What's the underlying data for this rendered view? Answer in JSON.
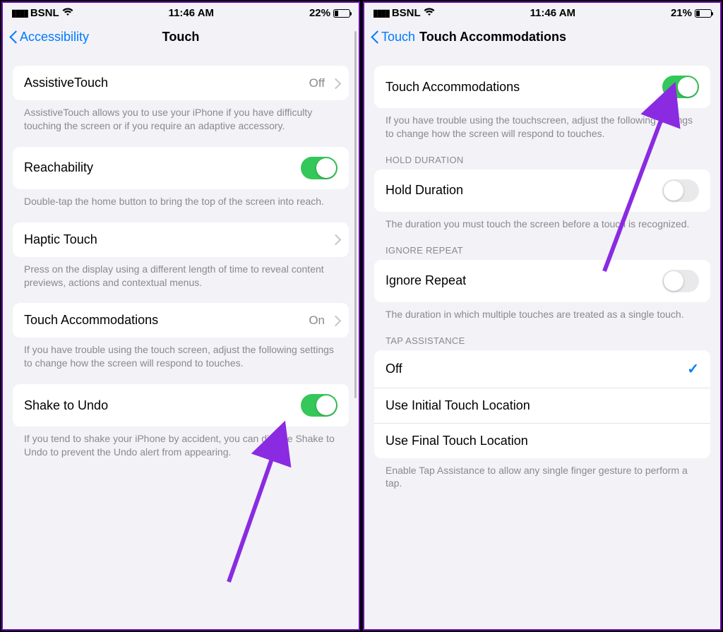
{
  "left": {
    "status": {
      "carrier": "BSNL",
      "time": "11:46 AM",
      "battery_pct": "22%",
      "battery_fill": 22
    },
    "nav": {
      "back": "Accessibility",
      "title": "Touch"
    },
    "rows": {
      "assistive": {
        "label": "AssistiveTouch",
        "value": "Off",
        "footer": "AssistiveTouch allows you to use your iPhone if you have difficulty touching the screen or if you require an adaptive accessory."
      },
      "reach": {
        "label": "Reachability",
        "on": true,
        "footer": "Double-tap the home button to bring the top of the screen into reach."
      },
      "haptic": {
        "label": "Haptic Touch",
        "footer": "Press on the display using a different length of time to reveal content previews, actions and contextual menus."
      },
      "accom": {
        "label": "Touch Accommodations",
        "value": "On",
        "footer": "If you have trouble using the touch screen, adjust the following settings to change how the screen will respond to touches."
      },
      "shake": {
        "label": "Shake to Undo",
        "on": true,
        "footer": "If you tend to shake your iPhone by accident, you can disable Shake to Undo to prevent the Undo alert from appearing."
      }
    }
  },
  "right": {
    "status": {
      "carrier": "BSNL",
      "time": "11:46 AM",
      "battery_pct": "21%",
      "battery_fill": 21
    },
    "nav": {
      "back": "Touch",
      "title": "Touch Accommodations"
    },
    "main": {
      "label": "Touch Accommodations",
      "on": true,
      "footer": "If you have trouble using the touchscreen, adjust the following settings to change how the screen will respond to touches."
    },
    "hold": {
      "header": "HOLD DURATION",
      "label": "Hold Duration",
      "on": false,
      "footer": "The duration you must touch the screen before a touch is recognized."
    },
    "ignore": {
      "header": "IGNORE REPEAT",
      "label": "Ignore Repeat",
      "on": false,
      "footer": "The duration in which multiple touches are treated as a single touch."
    },
    "tap": {
      "header": "TAP ASSISTANCE",
      "options": [
        "Off",
        "Use Initial Touch Location",
        "Use Final Touch Location"
      ],
      "selected": 0,
      "footer": "Enable Tap Assistance to allow any single finger gesture to perform a tap."
    }
  },
  "arrow_color": "#8a2be2"
}
